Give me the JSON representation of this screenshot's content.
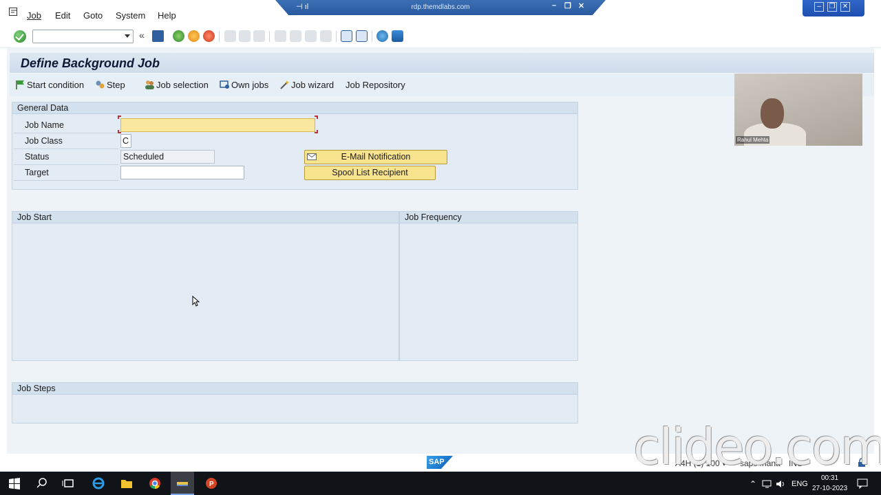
{
  "menu": {
    "items": [
      "Job",
      "Edit",
      "Goto",
      "System",
      "Help"
    ]
  },
  "rdp": {
    "title": "rdp.themdlabs.com"
  },
  "toolbar": {
    "command_value": ""
  },
  "screen": {
    "title": "Define Background Job"
  },
  "app_toolbar": {
    "start_condition": "Start condition",
    "step": "Step",
    "job_selection": "Job selection",
    "own_jobs": "Own jobs",
    "job_wizard": "Job wizard",
    "job_repository": "Job Repository"
  },
  "general_data": {
    "title": "General Data",
    "job_name_label": "Job Name",
    "job_name_value": "",
    "job_class_label": "Job Class",
    "job_class_value": "C",
    "status_label": "Status",
    "status_value": "Scheduled",
    "target_label": "Target",
    "target_value": "",
    "email_button": "E-Mail Notification",
    "spool_button": "Spool List Recipient"
  },
  "job_start": {
    "title": "Job Start"
  },
  "job_frequency": {
    "title": "Job Frequency"
  },
  "job_steps": {
    "title": "Job Steps"
  },
  "webcam": {
    "name": "Rahul Mehta"
  },
  "watermark": "clideo.com",
  "status": {
    "system": "A4H (1) 100",
    "server": "saps4hana",
    "mode": "INS"
  },
  "sap_logo": "SAP",
  "tray": {
    "lang": "ENG",
    "time": "00:31",
    "date": "27-10-2023"
  },
  "colors": {
    "focus_field": "#fbe8a0",
    "button": "#f8e38f",
    "panel": "#e3ecf5"
  }
}
